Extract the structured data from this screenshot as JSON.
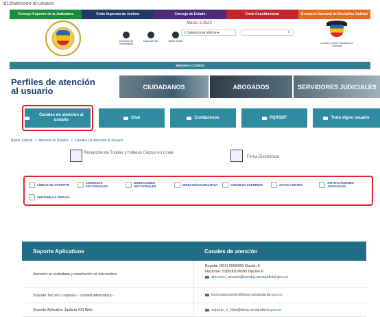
{
  "url": "id19/atencion-al-usuario",
  "topnav": [
    {
      "label": "Consejo Superior de la Judicatura",
      "color": "#1a8c3a"
    },
    {
      "label": "Corte Suprema de Justicia",
      "color": "#1d3c6a"
    },
    {
      "label": "Consejo de Estado",
      "color": "#4a2c7a"
    },
    {
      "label": "Corte Constitucional",
      "color": "#c8242e"
    },
    {
      "label": "Comisión Nacional de Disciplina Judicial",
      "color": "#e86a1e"
    }
  ],
  "header": {
    "date": "Marzo 3 2023",
    "icons": [
      {
        "label": "Directorio de Accesibilidad",
        "icon": "accessibility-icon"
      },
      {
        "label": "Mapa del Sitio",
        "icon": "sitemap-icon"
      },
      {
        "label": "Iniciar Sesión",
        "icon": "user-icon"
      }
    ],
    "lang_label": "Seleccionar idioma",
    "search_icon": "⌕",
    "coat_text": "Libertad y Orden República de Colombia"
  },
  "covid": "MEDIDAS COVID19",
  "perfiles": {
    "title_1": "Perfiles de atención",
    "title_2": "al usuario",
    "banners": [
      "CIUDADANOS",
      "ABOGADOS",
      "SERVIDORES JUDICIALES"
    ]
  },
  "channels": [
    "Canales de atención al usuario",
    "Chat",
    "Contáctenos",
    "PQRSDF",
    "Trato digno usuario"
  ],
  "breadcrumb": [
    "Rama Judicial",
    "Atención Al Usuario",
    "Canales De Atención Al Usuario"
  ],
  "breadcrumb_sep": ">",
  "mid": {
    "reception": "Recepción de Tutelas y Hábeas Corpus en Línea",
    "firma": "Firma Electrónica"
  },
  "links": [
    "LÍNEAS DE SOPORTE",
    "CONSEJOS SECCIONALES",
    "DIRECCIONES SECCIONALES",
    "DIRECCIÓN EJECUTIVA",
    "CONSEJO SUPERIOR",
    "ALTAS CORTES",
    "NOTIFICACIONES JUDICIALES",
    "VENTANILLA VIRTUAL"
  ],
  "table": {
    "headers": [
      "Soporte Aplicativos",
      "Canales de atención"
    ],
    "rows": [
      {
        "left": "Atención al ciudadano y orientación en Micrositios",
        "right": [
          "Bogotá: (601) 5556666 Opción 6",
          "Nacional: 018000124595 Opción 6"
        ],
        "mail": "atencion_usuario@cendoj.ramajudicial.gov.co"
      },
      {
        "left": "Soporte Técnico Logístico - Unidad Informática -",
        "right": [],
        "mail": "licenciassoporte@deaj.ramajudicial.gov.co"
      },
      {
        "left": "Soporte Aplicativo Justicia XXI Web",
        "right": [],
        "mail": "soporte_ri_tyba@deaj.ramajudicial.gov.co"
      }
    ]
  }
}
